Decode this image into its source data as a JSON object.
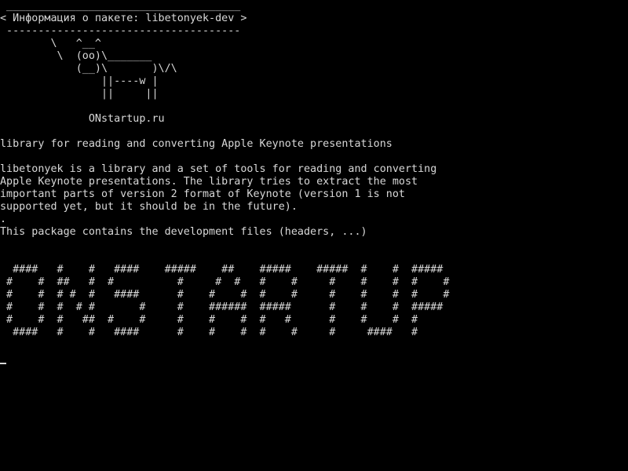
{
  "terminal": {
    "cowsay": {
      "top_border": " _____________________________________",
      "message": "< Информация о пакете: libetonyek-dev >",
      "bottom_border": " -------------------------------------",
      "cow_line1": "        \\   ^__^",
      "cow_line2": "         \\  (oo)\\_______",
      "cow_line3": "            (__)\\       )\\/\\",
      "cow_line4": "                ||----w |",
      "cow_line5": "                ||     ||"
    },
    "site": "              ONstartup.ru",
    "package": {
      "summary": "library for reading and converting Apple Keynote presentations",
      "description_line1": "libetonyek is a library and a set of tools for reading and converting",
      "description_line2": "Apple Keynote presentations. The library tries to extract the most",
      "description_line3": "important parts of version 2 format of Keynote (version 1 is not",
      "description_line4": "supported yet, but it should be in the future).",
      "separator": ".",
      "dev_note": "This package contains the development files (headers, ...)"
    },
    "banner": {
      "row1": "  ####   #    #   ####    #####    ##    #####    #####  #    #  #####",
      "row2": " #    #  ##   #  #          #     #  #   #    #     #    #    #  #    #",
      "row3": " #    #  # #  #   ####      #    #    #  #    #     #    #    #  #    #",
      "row4": " #    #  #  # #       #     #    ######  #####      #    #    #  #####",
      "row5": " #    #  #   ##  #    #     #    #    #  #   #      #    #    #  #",
      "row6": "  ####   #    #   ####      #    #    #  #    #     #     ####   #"
    }
  }
}
